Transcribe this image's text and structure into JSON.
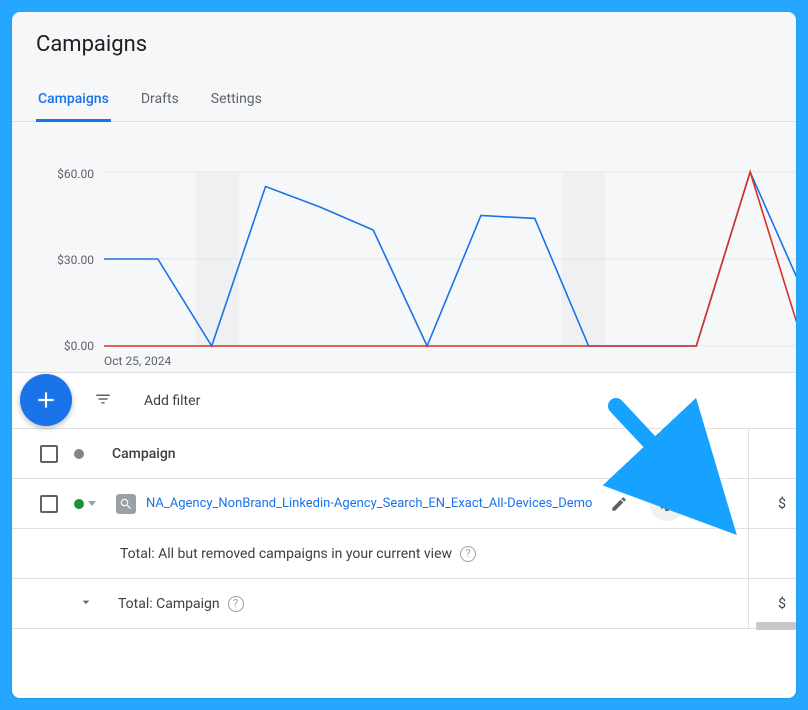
{
  "page": {
    "title": "Campaigns"
  },
  "tabs": [
    {
      "label": "Campaigns",
      "active": true
    },
    {
      "label": "Drafts",
      "active": false
    },
    {
      "label": "Settings",
      "active": false
    }
  ],
  "chart_data": {
    "type": "line",
    "title": "",
    "xlabel": "Oct 25, 2024",
    "ylabel": "",
    "ylim": [
      0,
      60
    ],
    "yticks": [
      0,
      30,
      60
    ],
    "x": [
      0,
      1,
      2,
      3,
      4,
      5,
      6,
      7,
      8,
      9,
      10,
      11,
      12,
      13
    ],
    "series": [
      {
        "name": "series-blue",
        "color": "#1a73e8",
        "values": [
          30,
          30,
          0,
          55,
          48,
          40,
          0,
          45,
          44,
          0,
          0,
          0,
          60,
          18
        ]
      },
      {
        "name": "series-red",
        "color": "#d93025",
        "values": [
          0,
          0,
          0,
          0,
          0,
          0,
          0,
          0,
          0,
          0,
          0,
          0,
          60,
          0
        ]
      }
    ],
    "shaded_x_ranges": [
      [
        1.7,
        2.5
      ],
      [
        8.5,
        9.3
      ]
    ],
    "ylabels": {
      "0": "$0.00",
      "30": "$30.00",
      "60": "$60.00"
    }
  },
  "filterbar": {
    "add_filter_label": "Add filter"
  },
  "table": {
    "header": {
      "campaign_label": "Campaign"
    },
    "rows": [
      {
        "status": "enabled",
        "type_icon": "search",
        "name": "NA_Agency_NonBrand_Linkedin-Agency_Search_EN_Exact_All-Devices_Demo",
        "value_col": "$"
      }
    ],
    "totals": [
      {
        "label": "Total: All but removed campaigns in your current view",
        "help": true,
        "indent": true,
        "value_col": ""
      },
      {
        "label": "Total: Campaign",
        "help": true,
        "expandable": true,
        "value_col": "$"
      }
    ]
  }
}
